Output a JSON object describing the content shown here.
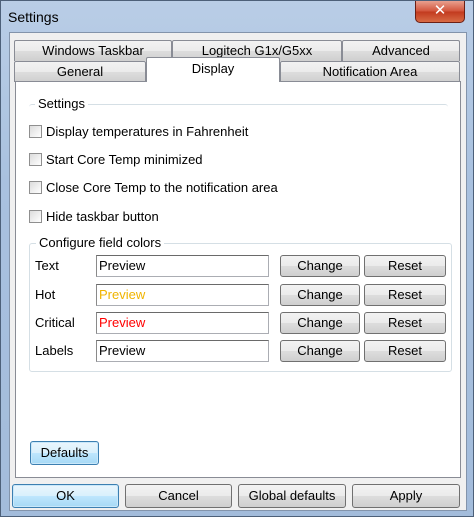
{
  "window": {
    "title": "Settings",
    "close_glyph": "✕"
  },
  "tabs": {
    "row_back": [
      "Windows Taskbar",
      "Logitech G1x/G5xx",
      "Advanced"
    ],
    "row_front": [
      "General",
      "Display",
      "Notification Area"
    ],
    "active": "Display"
  },
  "settings": {
    "legend": "Settings",
    "options": [
      {
        "label": "Display temperatures in Fahrenheit",
        "checked": false
      },
      {
        "label": "Start Core Temp minimized",
        "checked": false
      },
      {
        "label": "Close Core Temp to the notification area",
        "checked": false
      },
      {
        "label": "Hide taskbar button",
        "checked": false
      }
    ]
  },
  "colors": {
    "legend": "Configure field colors",
    "fields": [
      {
        "label": "Text",
        "preview": "Preview",
        "color": "#000000",
        "change_label": "Change",
        "reset_label": "Reset"
      },
      {
        "label": "Hot",
        "preview": "Preview",
        "color": "#f0b400",
        "change_label": "Change",
        "reset_label": "Reset"
      },
      {
        "label": "Critical",
        "preview": "Preview",
        "color": "#ff0000",
        "change_label": "Change",
        "reset_label": "Reset"
      },
      {
        "label": "Labels",
        "preview": "Preview",
        "color": "#000000",
        "change_label": "Change",
        "reset_label": "Reset"
      }
    ]
  },
  "buttons": {
    "defaults": "Defaults",
    "ok": "OK",
    "cancel": "Cancel",
    "global_defaults": "Global defaults",
    "apply": "Apply"
  }
}
